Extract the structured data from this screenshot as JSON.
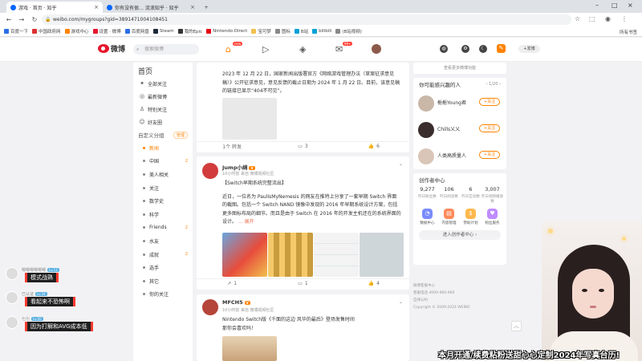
{
  "browser": {
    "tabs": [
      {
        "label": "游戏 · 首页 · 知乎"
      },
      {
        "label": "你有没有很… 流浪知乎 · 知乎"
      }
    ],
    "new_tab": "+",
    "url": "weibo.com/mygroups?gid=3891471004108451",
    "bookmarks": [
      "百度一下",
      "中国政府网",
      "游戏中心",
      "设置 · 微博",
      "百度网盘",
      "Steam",
      "我的Epic",
      "Nintendo Direct",
      "宝可梦",
      "图标",
      "B站",
      "bilibili",
      "(B站视频)"
    ],
    "bookmarks_all": "所有书签"
  },
  "weibo": {
    "logo_text": "微博",
    "search_placeholder": "搜索微博",
    "nav_badges": {
      "home": "new",
      "message": "99+"
    },
    "pill_label": "+发博",
    "sidebar": {
      "title": "首页",
      "items": [
        {
          "icon": "star-icon",
          "label": "全部关注"
        },
        {
          "icon": "globe-icon",
          "label": "最新微博"
        },
        {
          "icon": "user-icon",
          "label": "特别关注"
        },
        {
          "icon": "friends-icon",
          "label": "好友圈"
        }
      ],
      "group_title": "自定义分组",
      "group_manage": "管理",
      "groups": [
        {
          "label": "新闻",
          "active": true,
          "count": ""
        },
        {
          "label": "中国",
          "active": false,
          "count": "2"
        },
        {
          "label": "美人相关",
          "active": false,
          "count": ""
        },
        {
          "label": "关注",
          "active": false,
          "count": ""
        },
        {
          "label": "数学史",
          "active": false,
          "count": ""
        },
        {
          "label": "科学",
          "active": false,
          "count": ""
        },
        {
          "label": "Friends",
          "active": false,
          "count": "2"
        },
        {
          "label": "水友",
          "active": false,
          "count": ""
        },
        {
          "label": "成就",
          "active": false,
          "count": "2"
        },
        {
          "label": "选手",
          "active": false,
          "count": ""
        },
        {
          "label": "其它",
          "active": false,
          "count": ""
        },
        {
          "label": "你的关注",
          "active": false,
          "count": ""
        }
      ]
    },
    "posts": [
      {
        "text": "2023 年 12 月 22 日，国家新闻出版署官方《网络游戏管理办法（草案征求意见稿）》公开征求意见，意见反馈的截止日期为 2024 年 1 月 22 日。目前，该意见稿的链接已显示“404不可见”。",
        "actions": {
          "repost": "1个  转发",
          "comment": "3",
          "like": "6"
        }
      },
      {
        "author": "Jump小绵",
        "vip": "V",
        "meta": "10小时前 来自 微博视频社区",
        "title": "【Switch早期系统完整流出】",
        "text": "近日，一位名为 PaulIsMyNemesis 的网友在推特上分享了一套早期 Switch 界面的截图。包括一个 Switch NAND 镜像中发现的 2016 年早期系统设计方案，包括更多图标布局的细节。而且是由于 Switch 在 2016 年的开发主机还在的系统界面的设计。",
        "more": "... 展开",
        "actions": {
          "repost": "1",
          "comment": "1",
          "like": "4"
        }
      },
      {
        "author": "MFCH5",
        "vip": "V",
        "meta": "10小时前 来自 微博视频社区",
        "text": "Nintendo Switch版《千面的这边 风华的最后》登场发售时间",
        "text2": "那你会喜欢吗！"
      }
    ],
    "right": {
      "top_link": "查看更多微博功能",
      "rec_title": "你可能感兴趣的人",
      "rec_pager": "1/20",
      "people": [
        {
          "name": "栀栀Young君",
          "follow": "+关注"
        },
        {
          "name": "Chills乂乂",
          "follow": "+关注"
        },
        {
          "name": "人类高质量人",
          "follow": "+关注"
        }
      ],
      "creator_title": "创作者中心",
      "stats": [
        {
          "num": "9,277",
          "lab": "昨日粉丝数"
        },
        {
          "num": "106",
          "lab": "昨日阅读数"
        },
        {
          "num": "6",
          "lab": "昨日互动数"
        },
        {
          "num": "3,007",
          "lab": "昨日视频播放数"
        }
      ],
      "tools": [
        {
          "icon": "data-icon",
          "lab": "数据中心",
          "color": "#7b8cff"
        },
        {
          "icon": "fan-icon",
          "lab": "内容管理",
          "color": "#ff8a5b"
        },
        {
          "icon": "plan-icon",
          "lab": "赞助计划",
          "color": "#ffb84d"
        },
        {
          "icon": "fan-service-icon",
          "lab": "粉丝服务",
          "color": "#c08cff"
        }
      ],
      "enter_label": "进入创作者中心 ›",
      "footer": [
        "微博客服中心",
        "客服电话 4000-960-960",
        "自律公约",
        "Copyright © 2009-2024 WEIBO"
      ]
    }
  },
  "overlay": {
    "chat": [
      {
        "name": "嗯嗯嗯嗯嗯嗯",
        "level": "Lv.13",
        "message": "模式战熟"
      },
      {
        "name": "已认证",
        "level": "Lv.24",
        "message": "看起来不恐怖啊"
      },
      {
        "name": "七七",
        "level": "Lv.20",
        "message": "因为打解和AVG成本低"
      }
    ],
    "caption": "本月开通/续费粘粉送甜心心定制2024年写真台历!"
  }
}
